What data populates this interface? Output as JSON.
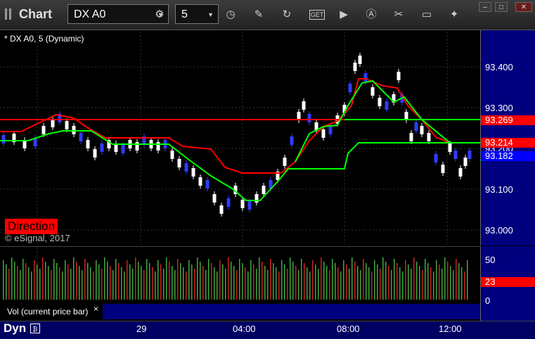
{
  "toolbar": {
    "title": "Chart",
    "symbol": "DX A0",
    "interval": "5",
    "icons": [
      "settings-icon",
      "clock-icon",
      "pencil-icon",
      "refresh-icon",
      "get-icon",
      "play-icon",
      "alert-icon",
      "tools-icon",
      "chat-icon",
      "twitter-icon"
    ]
  },
  "chart": {
    "symbol_label": "* DX A0, 5 (Dynamic)",
    "direction_label": "Direction",
    "copyright": "© eSignal, 2017",
    "price_ticks": [
      "93.400",
      "93.300",
      "93.200",
      "93.100",
      "93.000"
    ],
    "price_tags": [
      {
        "label": "93.269",
        "color": "#ff0000"
      },
      {
        "label": "93.214",
        "color": "#ff0000"
      },
      {
        "label": "93.200",
        "color": "#0000ff"
      },
      {
        "label": "93.182",
        "color": "#0000ff"
      }
    ],
    "colors": {
      "up": "#ffffff",
      "down": "#2f3cff",
      "red_line": "#ff0000",
      "green_line": "#00ff00"
    }
  },
  "volume": {
    "ticks": [
      "50",
      "0"
    ],
    "current_tag": "23",
    "study_label": "Vol (current price bar)",
    "close_label": "×"
  },
  "timescale": {
    "labels": [
      "29",
      "04:00",
      "08:00",
      "12:00"
    ],
    "dyn_label": "Dyn",
    "dyn_icon": "₿"
  },
  "window": {
    "min": "–",
    "max": "□",
    "close": "✕"
  }
}
